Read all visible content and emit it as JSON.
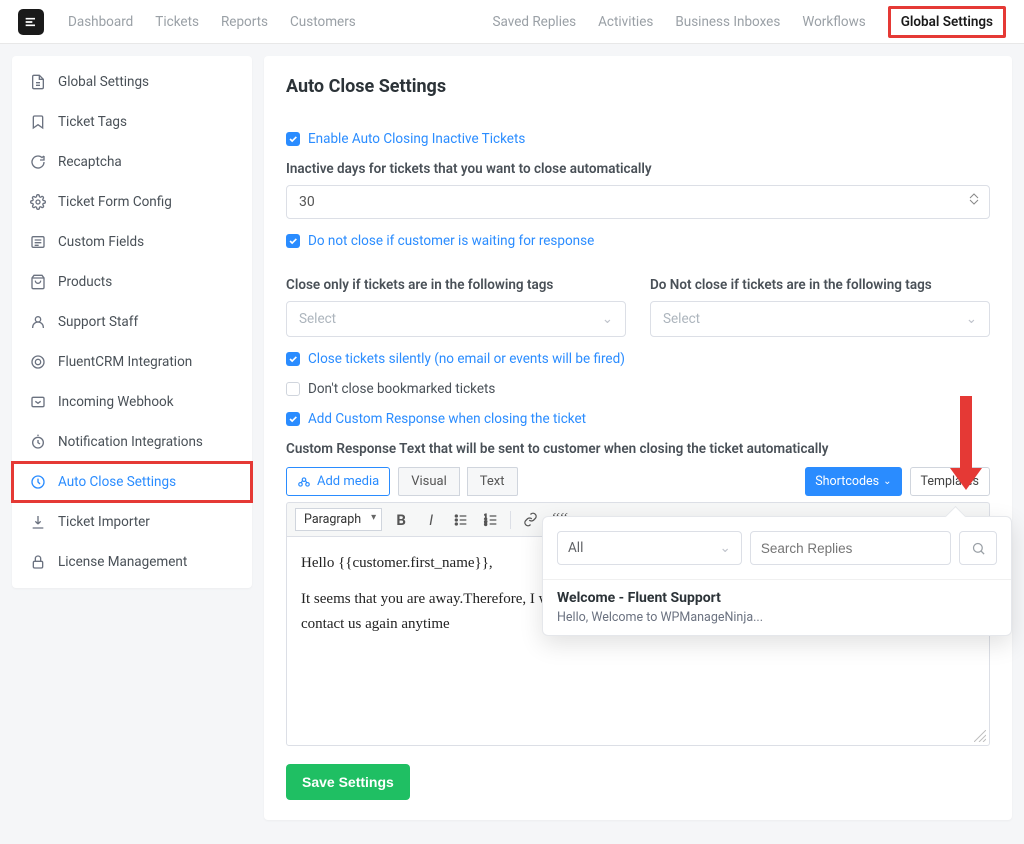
{
  "nav": {
    "left": [
      "Dashboard",
      "Tickets",
      "Reports",
      "Customers"
    ],
    "right": [
      "Saved Replies",
      "Activities",
      "Business Inboxes",
      "Workflows",
      "Global Settings"
    ]
  },
  "sidebar": {
    "items": [
      {
        "icon": "document-icon",
        "label": "Global Settings"
      },
      {
        "icon": "bookmark-icon",
        "label": "Ticket Tags"
      },
      {
        "icon": "recaptcha-icon",
        "label": "Recaptcha"
      },
      {
        "icon": "gear-icon",
        "label": "Ticket Form Config"
      },
      {
        "icon": "list-icon",
        "label": "Custom Fields"
      },
      {
        "icon": "bag-icon",
        "label": "Products"
      },
      {
        "icon": "user-icon",
        "label": "Support Staff"
      },
      {
        "icon": "link-icon",
        "label": "FluentCRM Integration"
      },
      {
        "icon": "webhook-icon",
        "label": "Incoming Webhook"
      },
      {
        "icon": "bell-icon",
        "label": "Notification Integrations"
      },
      {
        "icon": "clock-icon",
        "label": "Auto Close Settings",
        "active": true
      },
      {
        "icon": "download-icon",
        "label": "Ticket Importer"
      },
      {
        "icon": "lock-icon",
        "label": "License Management"
      }
    ]
  },
  "page": {
    "title": "Auto Close Settings",
    "enable_label": "Enable Auto Closing Inactive Tickets",
    "inactive_days_label": "Inactive days for tickets that you want to close automatically",
    "inactive_days_value": "30",
    "no_close_waiting_label": "Do not close if customer is waiting for response",
    "close_only_tags_label": "Close only if tickets are in the following tags",
    "dont_close_tags_label": "Do Not close if tickets are in the following tags",
    "select_placeholder": "Select",
    "close_silently_label": "Close tickets silently (no email or events will be fired)",
    "dont_close_bookmarked_label": "Don't close bookmarked tickets",
    "add_custom_response_label": "Add Custom Response when closing the ticket",
    "custom_response_label": "Custom Response Text that will be sent to customer when closing the ticket automatically",
    "add_media_label": "Add media",
    "tab_visual": "Visual",
    "tab_text": "Text",
    "shortcodes_label": "Shortcodes",
    "templates_label": "Templates",
    "paragraph_label": "Paragraph",
    "editor_line1": "Hello {{customer.first_name}},",
    "editor_line2": "It seems that you are away.Therefore, I will b",
    "editor_line3": "contact us again anytime",
    "save_label": "Save Settings"
  },
  "popover": {
    "filter_label": "All",
    "search_placeholder": "Search Replies",
    "items": [
      {
        "title": "Welcome - Fluent Support",
        "snippet": "Hello, Welcome to WPManageNinja..."
      }
    ]
  }
}
